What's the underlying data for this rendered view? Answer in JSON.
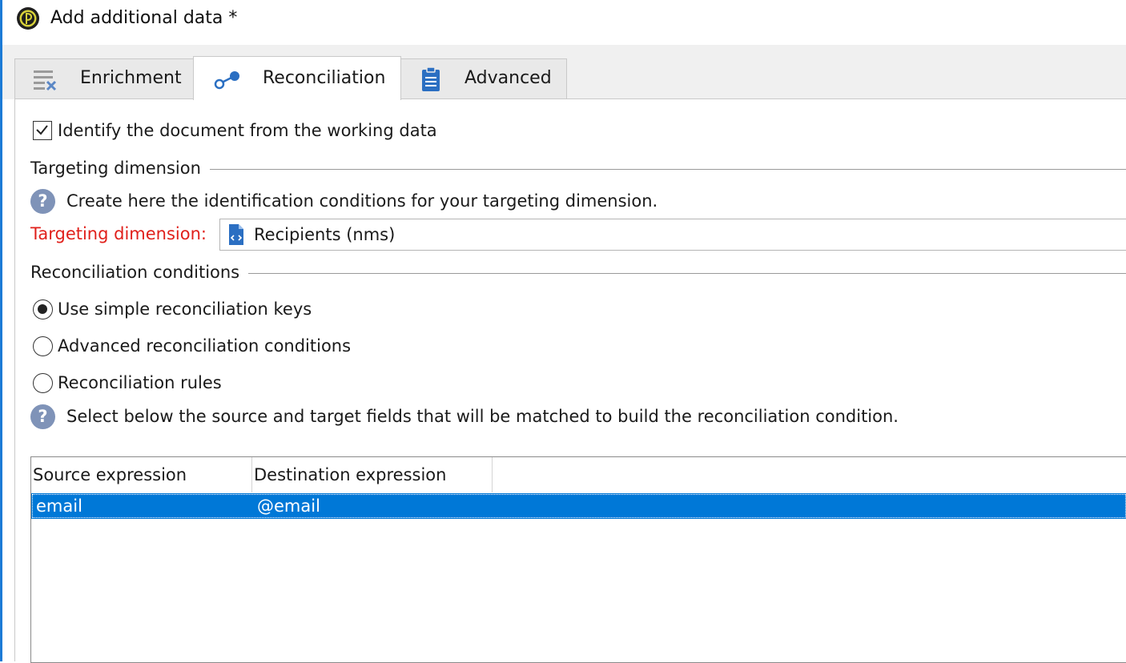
{
  "window": {
    "title": "Add additional data *"
  },
  "tabs": [
    {
      "label": "Enrichment",
      "icon": "enrichment-icon",
      "active": false
    },
    {
      "label": "Reconciliation",
      "icon": "reconciliation-icon",
      "active": true
    },
    {
      "label": "Advanced",
      "icon": "clipboard-icon",
      "active": false
    }
  ],
  "reconciliation": {
    "identify_checkbox": {
      "label": "Identify the document from the working data",
      "checked": true
    },
    "targeting_section": {
      "heading": "Targeting dimension",
      "help_text": "Create here the identification conditions for your targeting dimension.",
      "field_label": "Targeting dimension:",
      "field_value": "Recipients (nms)"
    },
    "conditions_section": {
      "heading": "Reconciliation conditions",
      "options": [
        {
          "label": "Use simple reconciliation keys",
          "selected": true
        },
        {
          "label": "Advanced reconciliation conditions",
          "selected": false
        },
        {
          "label": "Reconciliation rules",
          "selected": false
        }
      ],
      "help_text": "Select below the source and target fields that will be matched to build the reconciliation condition."
    },
    "grid": {
      "columns": [
        "Source expression",
        "Destination expression"
      ],
      "rows": [
        {
          "source": "email",
          "destination": "@email",
          "selected": true
        }
      ]
    }
  },
  "colors": {
    "accent": "#0078d7",
    "required_label": "#e0201b",
    "help_icon": "#7f93b8",
    "window_border": "#1c7bd6"
  }
}
